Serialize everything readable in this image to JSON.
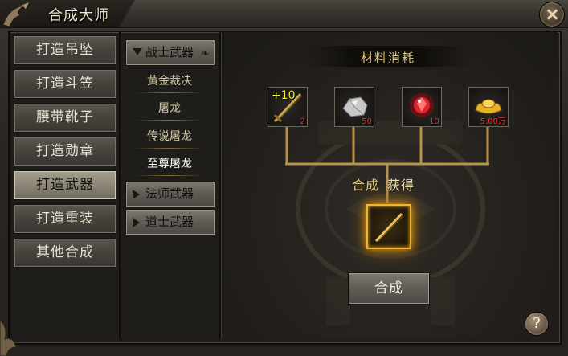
{
  "window": {
    "title": "合成大师"
  },
  "left_menu": {
    "items": [
      {
        "label": "打造吊坠",
        "selected": false
      },
      {
        "label": "打造斗笠",
        "selected": false
      },
      {
        "label": "腰带靴子",
        "selected": false
      },
      {
        "label": "打造勋章",
        "selected": false
      },
      {
        "label": "打造武器",
        "selected": true
      },
      {
        "label": "打造重装",
        "selected": false
      },
      {
        "label": "其他合成",
        "selected": false
      }
    ]
  },
  "categories": [
    {
      "label": "战士武器",
      "expanded": true,
      "items": [
        {
          "label": "黄金裁决",
          "selected": false
        },
        {
          "label": "屠龙",
          "selected": false
        },
        {
          "label": "传说屠龙",
          "selected": false
        },
        {
          "label": "至尊屠龙",
          "selected": true
        }
      ]
    },
    {
      "label": "法师武器",
      "expanded": false
    },
    {
      "label": "道士武器",
      "expanded": false
    }
  ],
  "materials": {
    "title": "材料消耗",
    "items": [
      {
        "icon": "sword-icon",
        "enhance": "+10",
        "count": "2"
      },
      {
        "icon": "ore-icon",
        "count": "50"
      },
      {
        "icon": "red-gem-icon",
        "count": "10"
      },
      {
        "icon": "gold-ingot-icon",
        "count": "5.00万"
      }
    ]
  },
  "result": {
    "label_a": "合成",
    "label_b": "获得",
    "icon": "sword-icon"
  },
  "buttons": {
    "synthesize": "合成",
    "help": "?"
  },
  "colors": {
    "accent_gold": "#e5c97a",
    "count_red": "#ff2b2b",
    "result_glow": "#f0b630"
  }
}
